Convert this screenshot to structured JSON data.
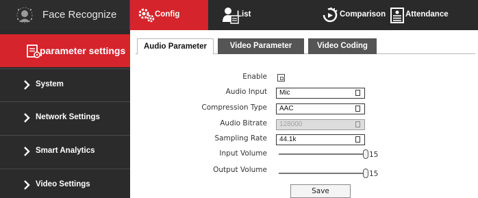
{
  "app": {
    "title": "Face Recognize"
  },
  "nav": {
    "tabs": [
      {
        "label": "Config",
        "icon": "gears-icon",
        "active": true
      },
      {
        "label": "List",
        "icon": "user-list-icon",
        "active": false
      },
      {
        "label": "Comparison",
        "icon": "comparison-icon",
        "active": false
      },
      {
        "label": "Attendance",
        "icon": "attendance-icon",
        "active": false
      }
    ]
  },
  "sidebar": {
    "header": {
      "label": "parameter settings",
      "icon": "settings-document-icon"
    },
    "items": [
      {
        "label": "System",
        "icon": "chevron-right-icon"
      },
      {
        "label": "Network Settings",
        "icon": "chevron-right-icon"
      },
      {
        "label": "Smart Analytics",
        "icon": "chevron-right-icon"
      },
      {
        "label": "Video Settings",
        "icon": "chevron-right-icon"
      }
    ]
  },
  "subtabs": [
    {
      "label": "Audio Parameter",
      "active": true
    },
    {
      "label": "Video Parameter",
      "active": false
    },
    {
      "label": "Video Coding",
      "active": false
    }
  ],
  "form": {
    "enable": {
      "label": "Enable",
      "checked": false
    },
    "audio_input": {
      "label": "Audio Input",
      "value": "Mic"
    },
    "compression_type": {
      "label": "Compression Type",
      "value": "AAC"
    },
    "audio_bitrate": {
      "label": "Audio Bitrate",
      "value": "128000",
      "disabled": true
    },
    "sampling_rate": {
      "label": "Sampling Rate",
      "value": "44.1k"
    },
    "input_volume": {
      "label": "Input Volume",
      "value": "15",
      "level": 1.0
    },
    "output_volume": {
      "label": "Output Volume",
      "value": "15",
      "level": 1.0
    },
    "save_label": "Save"
  },
  "colors": {
    "accent": "#d5242c",
    "topbar": "#2a2a2a",
    "sidebar": "#2b2b2b",
    "inactive_subtab": "#555555"
  }
}
